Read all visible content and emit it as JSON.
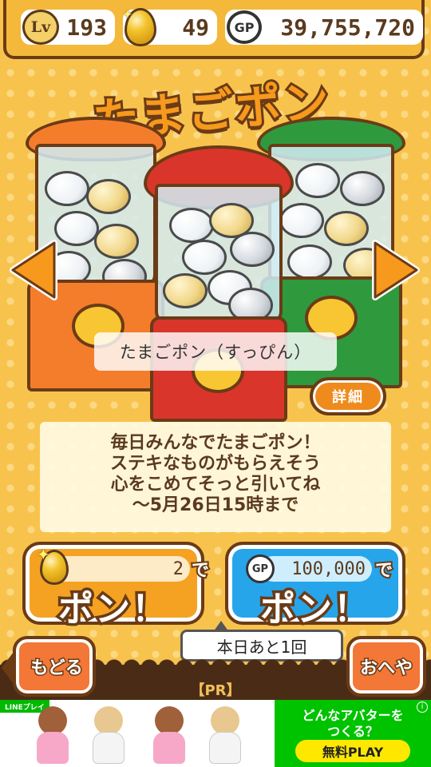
{
  "status": {
    "level_badge": "Lv",
    "level": "193",
    "eggs": "49",
    "gp_badge": "GP",
    "gp": "39,755,720"
  },
  "title": "たまごポン",
  "gacha": {
    "name": "たまごポン（すっぴん）",
    "detail_label": "詳細",
    "description": [
      "毎日みんなでたまごポン！",
      "ステキなものがもらえそう",
      "心をこめてそっと引いてね",
      "〜5月26日15時まで"
    ]
  },
  "buttons": {
    "egg_cost": "2",
    "egg_de": "で",
    "egg_pon": "ポン！",
    "gp_badge": "GP",
    "gp_cost": "100,000",
    "gp_de": "で",
    "gp_pon": "ポン！"
  },
  "remaining": "本日あと1回",
  "nav": {
    "back": "もどる",
    "room": "おへや",
    "pr": "【PR】"
  },
  "ad": {
    "tag": "LINEプレイ",
    "title_line1": "どんなアバターを",
    "title_line2": "つくる？",
    "cta": "無料PLAY",
    "info": "i"
  },
  "colors": {
    "background": "#f8c34d",
    "machine_orange": "#f47d2c",
    "machine_red": "#d9352b",
    "machine_green": "#2e9a3d",
    "button_orange": "#f5a223",
    "button_blue": "#27a5ea",
    "outline_brown": "#6b3b16"
  }
}
